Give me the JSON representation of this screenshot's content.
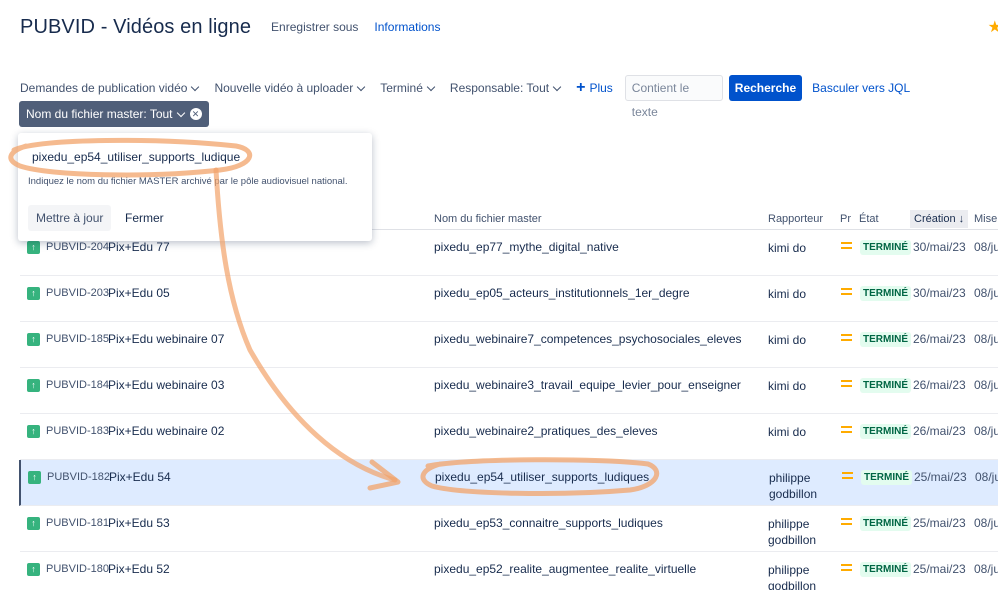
{
  "header": {
    "title": "PUBVID - Vidéos en ligne",
    "save_as": "Enregistrer sous",
    "info": "Informations"
  },
  "colors": {
    "accent": "#0052cc",
    "status_done_bg": "#e3fcef",
    "status_done_text": "#006644",
    "annotation": "#f2a36a"
  },
  "filters": {
    "items": [
      "Demandes de publication vidéo",
      "Nouvelle vidéo à uploader",
      "Terminé",
      "Responsable: Tout"
    ],
    "more": "Plus",
    "search_placeholder": "Contient le texte",
    "search_button": "Recherche",
    "jql": "Basculer vers JQL",
    "chip": "Nom du fichier master: Tout"
  },
  "popup": {
    "value": "pixedu_ep54_utiliser_supports_ludique",
    "help": "Indiquez le nom du fichier MASTER archivé par le pôle audiovisuel national.",
    "update": "Mettre à jour",
    "close": "Fermer"
  },
  "columns": {
    "master": "Nom du fichier master",
    "reporter": "Rapporteur",
    "priority": "Pr",
    "status": "État",
    "created": "Création",
    "mise": "Mise"
  },
  "rows": [
    {
      "key": "PUBVID-204",
      "summary": "Pix+Edu 77",
      "master": "pixedu_ep77_mythe_digital_native",
      "reporter": "kimi do",
      "status": "TERMINÉ",
      "created": "30/mai/23",
      "mise": "08/ju"
    },
    {
      "key": "PUBVID-203",
      "summary": "Pix+Edu 05",
      "master": "pixedu_ep05_acteurs_institutionnels_1er_degre",
      "reporter": "kimi do",
      "status": "TERMINÉ",
      "created": "30/mai/23",
      "mise": "08/ju"
    },
    {
      "key": "PUBVID-185",
      "summary": "Pix+Edu webinaire 07",
      "master": "pixedu_webinaire7_competences_psychosociales_eleves",
      "reporter": "kimi do",
      "status": "TERMINÉ",
      "created": "26/mai/23",
      "mise": "08/ju"
    },
    {
      "key": "PUBVID-184",
      "summary": "Pix+Edu webinaire 03",
      "master": "pixedu_webinaire3_travail_equipe_levier_pour_enseigner",
      "reporter": "kimi do",
      "status": "TERMINÉ",
      "created": "26/mai/23",
      "mise": "08/ju"
    },
    {
      "key": "PUBVID-183",
      "summary": "Pix+Edu webinaire 02",
      "master": "pixedu_webinaire2_pratiques_des_eleves",
      "reporter": "kimi do",
      "status": "TERMINÉ",
      "created": "26/mai/23",
      "mise": "08/ju"
    },
    {
      "key": "PUBVID-182",
      "summary": "Pix+Edu 54",
      "master": "pixedu_ep54_utiliser_supports_ludiques",
      "reporter": "philippe godbillon",
      "status": "TERMINÉ",
      "created": "25/mai/23",
      "mise": "08/ju"
    },
    {
      "key": "PUBVID-181",
      "summary": "Pix+Edu 53",
      "master": "pixedu_ep53_connaitre_supports_ludiques",
      "reporter": "philippe godbillon",
      "status": "TERMINÉ",
      "created": "25/mai/23",
      "mise": "08/ju"
    },
    {
      "key": "PUBVID-180",
      "summary": "Pix+Edu 52",
      "master": "pixedu_ep52_realite_augmentee_realite_virtuelle",
      "reporter": "philippe godbillon",
      "status": "TERMINÉ",
      "created": "25/mai/23",
      "mise": "08/ju"
    }
  ]
}
